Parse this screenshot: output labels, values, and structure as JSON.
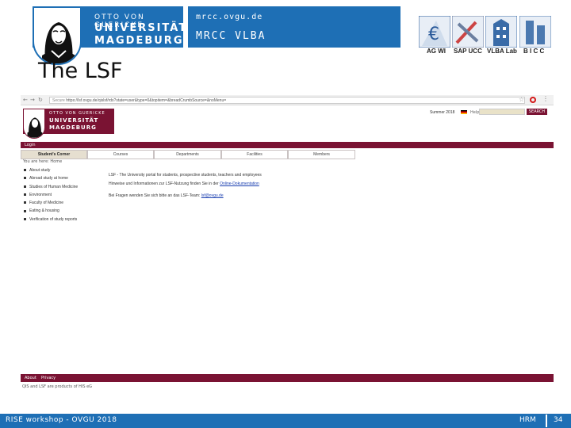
{
  "header": {
    "ovgu_logo": {
      "line1": "OTTO VON GUERICKE",
      "line2": "UNIVERSITÄT",
      "line3": "MAGDEBURG"
    },
    "mrcc_logo": {
      "url": "mrcc.ovgu.de",
      "name": "MRCC VLBA"
    },
    "partners": [
      {
        "label": "AG WI",
        "icon": "euro-icon",
        "color": "#2a5a9a"
      },
      {
        "label": "SAP UCC",
        "icon": "tools-icon",
        "color": "#6b7fa0"
      },
      {
        "label": "VLBA Lab",
        "icon": "building-icon",
        "color": "#3a6ca8"
      },
      {
        "label": "B I C C",
        "icon": "server-icon",
        "color": "#4b79b0"
      }
    ]
  },
  "slide_title": "The LSF",
  "browser": {
    "address": "https://lsf.ovgu.de/qislsf/rds?state=user&type=0&topitem=&breadCrumbSource=&noMenu=",
    "secure_label": "Secure"
  },
  "lsf": {
    "logo": {
      "line1": "OTTO VON GUERICKE",
      "line2": "UNIVERSITÄT",
      "line3": "MAGDEBURG"
    },
    "semester": "Summer 2018",
    "search_label": "Help",
    "search_placeholder": "",
    "search_button": "SEARCH",
    "login": "Login",
    "tabs": [
      "Student's Corner",
      "Courses",
      "Departments",
      "Facilities",
      "Members"
    ],
    "breadcrumb": "You are here: Home",
    "side_items": [
      "About study",
      "Abroad study at home",
      "Studies of Human Medicine",
      "Environment",
      "Faculty of Medicine",
      "Eating & housing",
      "Verification of study reports"
    ],
    "intro": "LSF - The University portal for students, prospective students, teachers and employees",
    "hint_prefix": "Hinweise und Informationen zur LSF-Nutzung finden Sie in der ",
    "hint_link": "Online-Dokumentation",
    "contact_prefix": "Bei Fragen wenden Sie sich bitte an das LSF-Team: ",
    "contact_link": "lsf@ovgu.de",
    "footer_links": [
      "About",
      "Privacy"
    ],
    "footer_note": "QIS and LSF are products of HIS eG"
  },
  "footer": {
    "left": "RISE workshop - OVGU 2018",
    "author": "HRM",
    "page": "34"
  }
}
